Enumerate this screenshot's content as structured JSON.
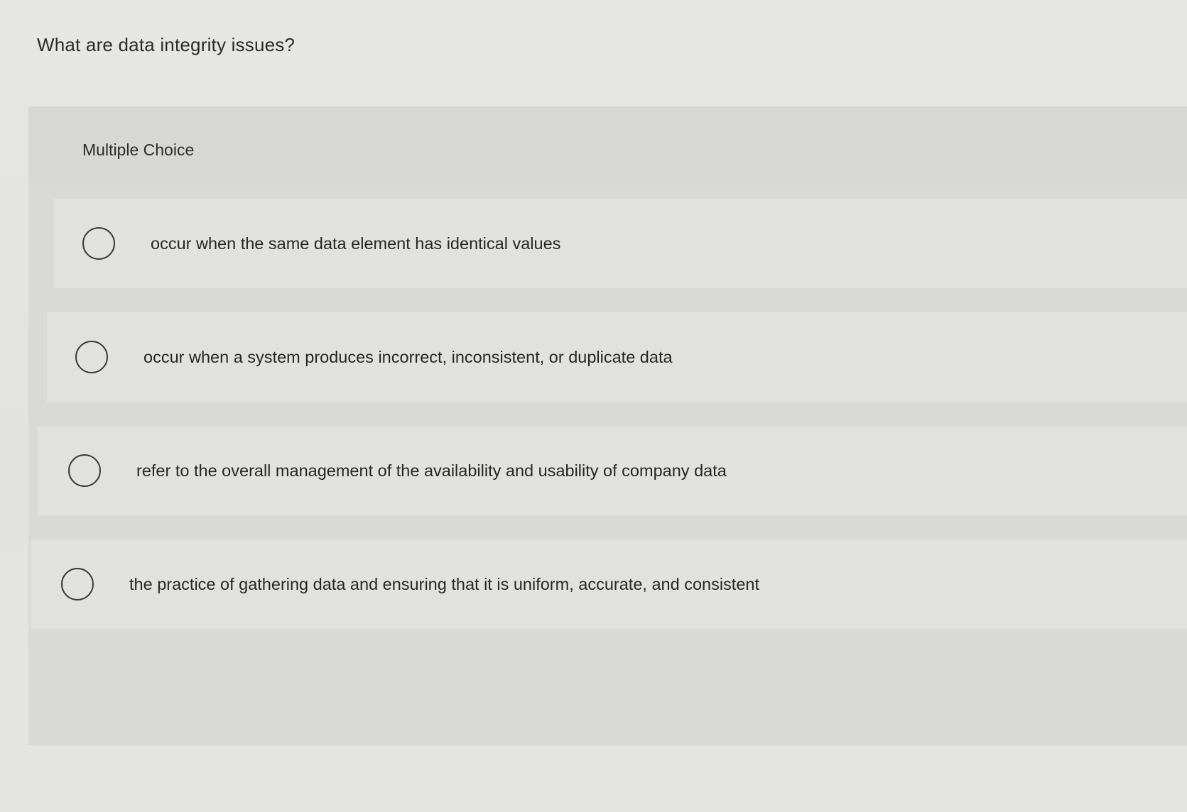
{
  "question": {
    "text": "What are data integrity issues?"
  },
  "panel": {
    "type_label": "Multiple Choice"
  },
  "options": [
    {
      "label": "occur when the same data element has identical values",
      "selected": false
    },
    {
      "label": "occur when a system produces incorrect, inconsistent, or duplicate data",
      "selected": false
    },
    {
      "label": "refer to the overall management of the availability and usability of company data",
      "selected": false
    },
    {
      "label": "the practice of gathering data and ensuring that it is uniform, accurate, and consistent",
      "selected": false
    }
  ],
  "icons": {
    "radio": "radio-unchecked-icon"
  }
}
